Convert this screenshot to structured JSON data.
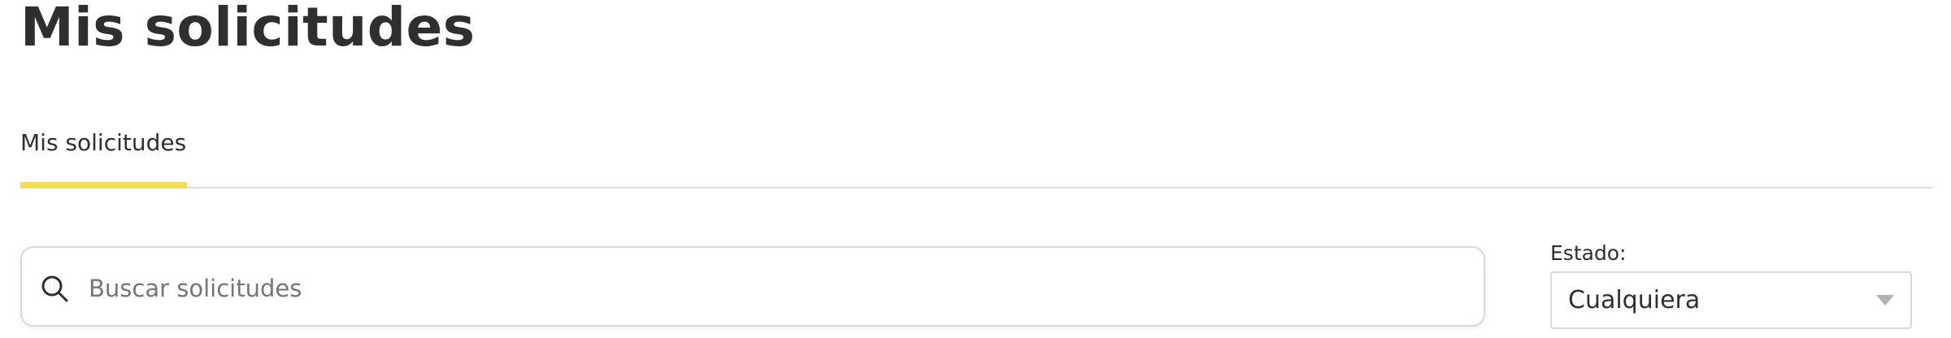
{
  "page": {
    "title": "Mis solicitudes"
  },
  "tabs": [
    {
      "label": "Mis solicitudes",
      "active": true
    }
  ],
  "search": {
    "value": "",
    "placeholder": "Buscar solicitudes",
    "icon": "search-icon"
  },
  "filter": {
    "label": "Estado:",
    "selected": "Cualquiera",
    "icon": "chevron-down-icon"
  },
  "colors": {
    "accent": "#f5dc55",
    "text": "#2f2f2f",
    "placeholder": "#767676",
    "border": "#d9d9d9"
  }
}
